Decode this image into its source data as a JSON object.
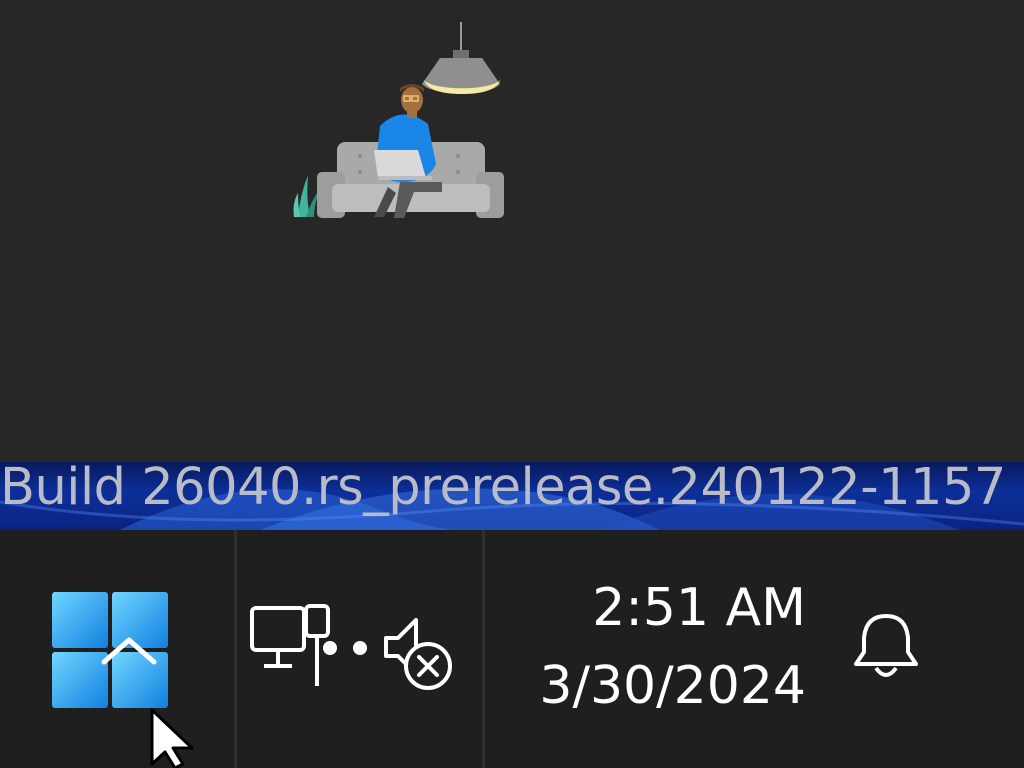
{
  "build_info": {
    "text": "Build 26040.rs_prerelease.240122-1157"
  },
  "taskbar": {
    "start": {
      "icon": "windows-logo-icon"
    },
    "tray": {
      "network_icon": "network-wired-icon",
      "volume_icon": "volume-muted-icon"
    },
    "clock": {
      "time": "2:51 AM",
      "date": "3/30/2024"
    },
    "notifications": {
      "icon": "bell-icon"
    }
  },
  "colors": {
    "background": "#272727",
    "taskbar": "#1f1f1f",
    "accent": "#1a9bf0",
    "lamp": "#f5e9a3"
  }
}
